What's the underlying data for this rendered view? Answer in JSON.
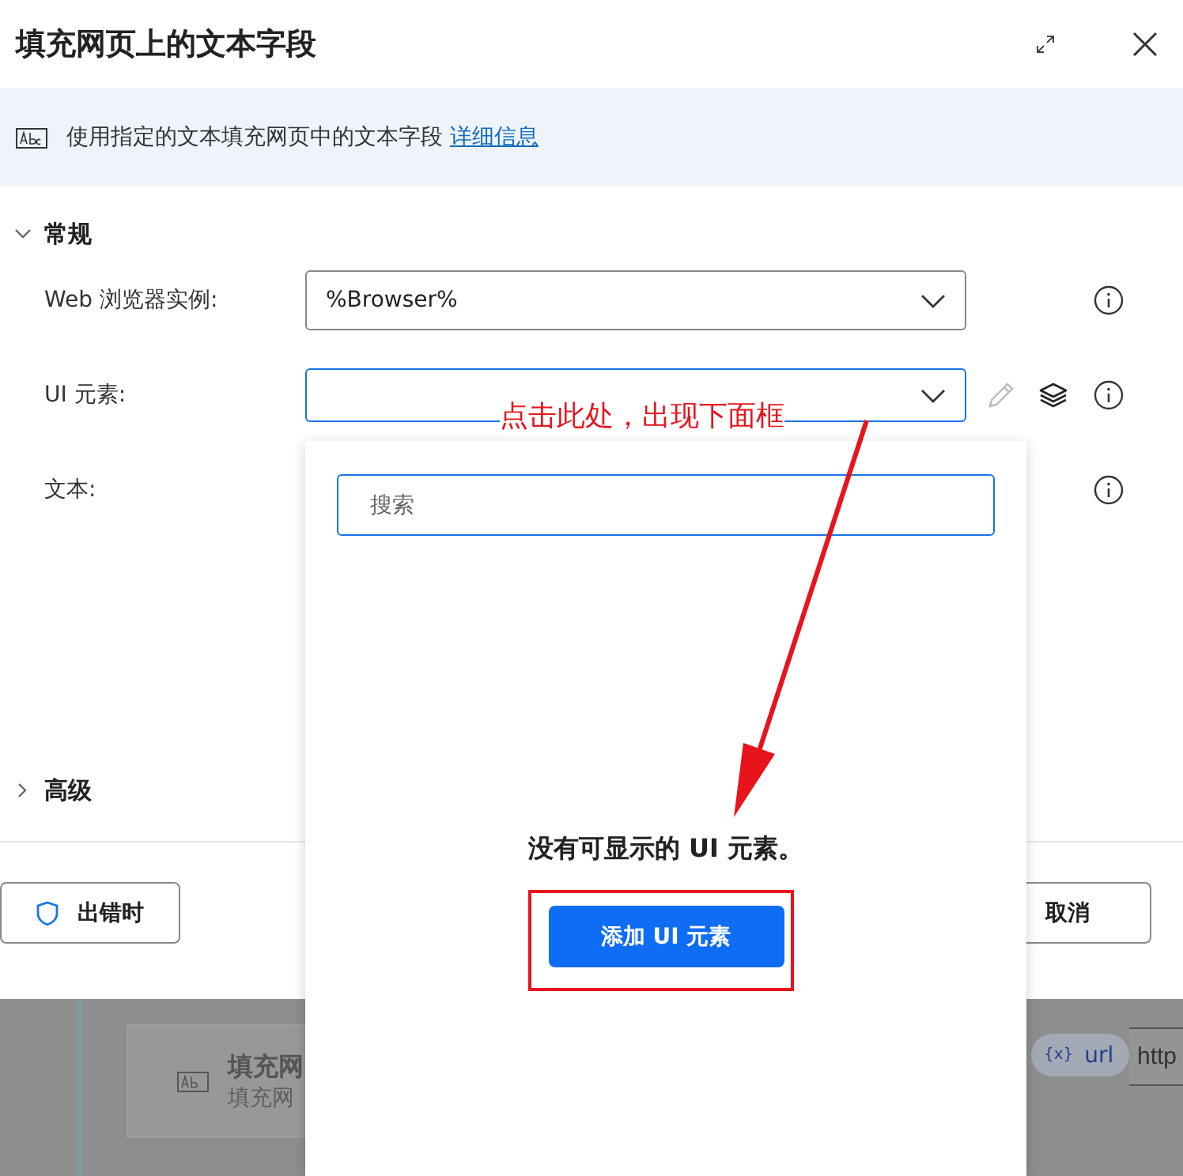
{
  "dialog": {
    "title": "填充网页上的文本字段",
    "description": "使用指定的文本填充网页中的文本字段",
    "details_link": "详细信息"
  },
  "general": {
    "label": "常规",
    "expanded": true
  },
  "fields": [
    {
      "label": "Web 浏览器实例:",
      "kind": "ui_dropdown",
      "value": "%Browser%",
      "focused": false,
      "tools": false
    },
    {
      "label": "UI 元素:",
      "kind": "ui_dropdown",
      "focused": true,
      "tools": true
    },
    {
      "label": "文本:",
      "kind": "text"
    }
  ],
  "advanced": {
    "label": "高级",
    "expanded": false
  },
  "footer": {
    "error_button": "出错时",
    "cancel_button": "取消"
  },
  "popup": {
    "search_placeholder": "搜索",
    "empty_message": "没有可显示的 UI 元素。",
    "add_button": "添加 UI 元素"
  },
  "annotation": {
    "text": "点击此处，出现下面框"
  },
  "background": {
    "card_title": "填充网",
    "card_subtitle": "填充网",
    "chip_icon": "{x}",
    "chip_label": "url",
    "field_value": "http"
  }
}
